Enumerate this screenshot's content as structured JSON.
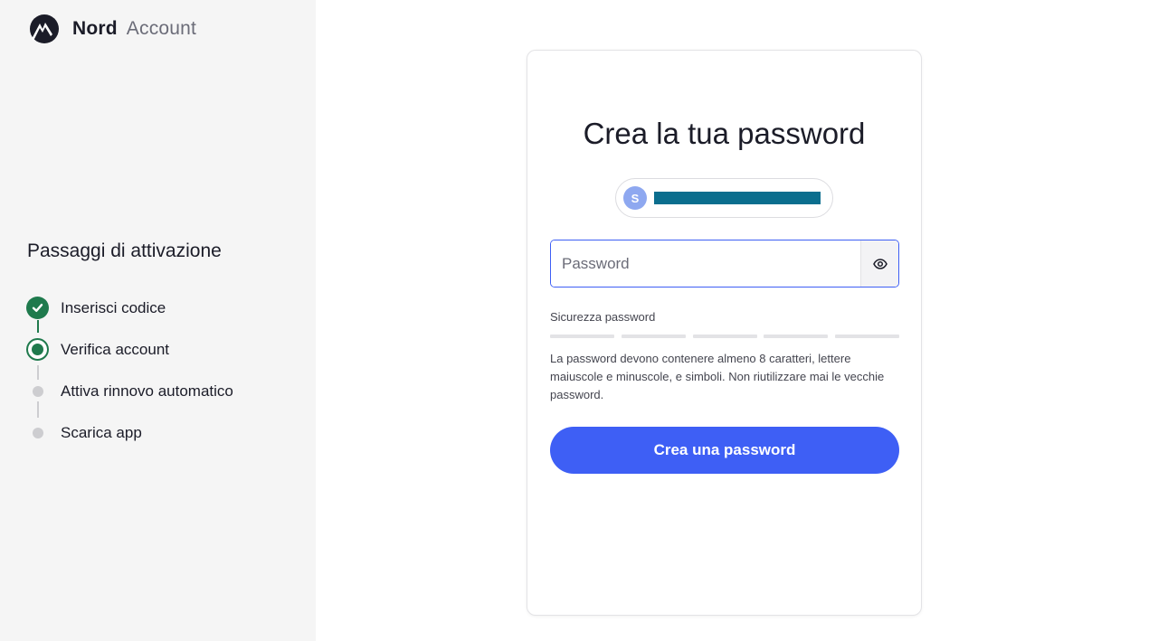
{
  "brand": {
    "name": "Nord",
    "product": "Account",
    "logo_icon": "nord-mountain-logo"
  },
  "sidebar": {
    "title": "Passaggi di attivazione",
    "steps": [
      {
        "label": "Inserisci codice",
        "status": "done"
      },
      {
        "label": "Verifica account",
        "status": "current"
      },
      {
        "label": "Attiva rinnovo automatico",
        "status": "pending"
      },
      {
        "label": "Scarica app",
        "status": "pending"
      }
    ]
  },
  "form": {
    "title": "Crea la tua password",
    "email": {
      "avatar_letter": "S",
      "value_redacted": true
    },
    "password": {
      "placeholder": "Password",
      "value": ""
    },
    "strength_label": "Sicurezza password",
    "strength_level": 0,
    "strength_segments": 5,
    "hint": "La password devono contenere almeno 8 caratteri, lettere maiuscole e minuscole, e simboli. Non riutilizzare mai le vecchie password.",
    "submit_label": "Crea una password"
  },
  "colors": {
    "accent": "#3e5ff5",
    "success": "#1f7a4d",
    "pending": "#cdcdd0",
    "sidebar_bg": "#f5f5f5",
    "redaction": "#0b6e8e"
  }
}
